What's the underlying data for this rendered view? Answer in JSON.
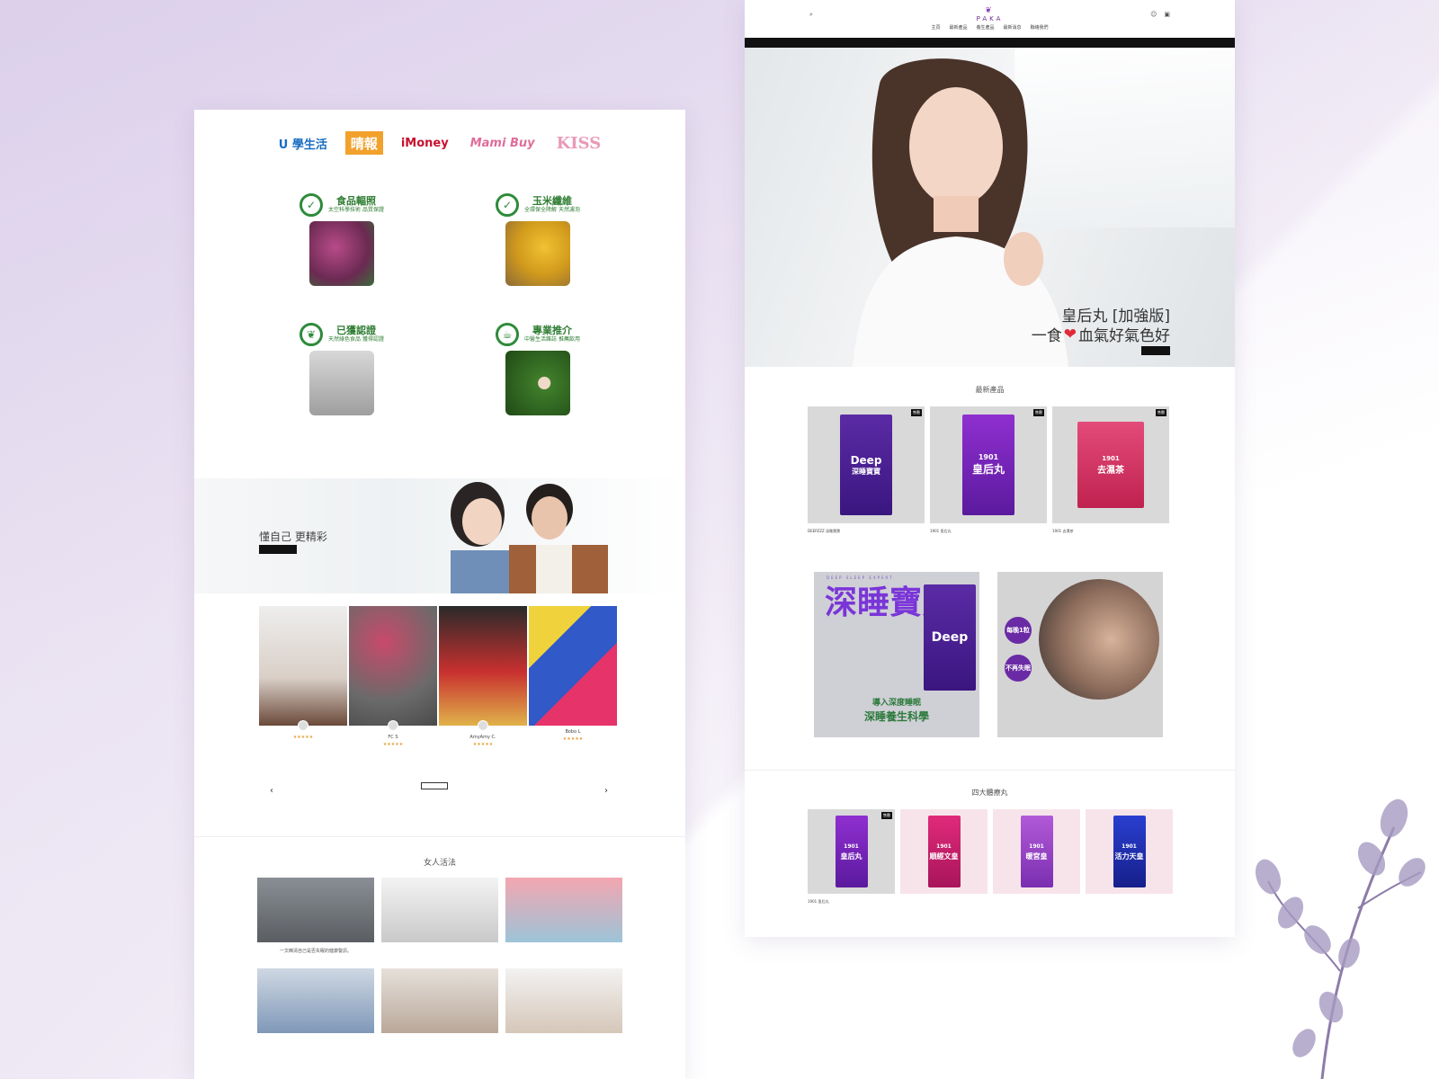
{
  "left_page": {
    "media_logos": [
      "U 學生活",
      "晴報",
      "iMoney",
      "Mami Buy",
      "KISS"
    ],
    "features": [
      {
        "title": "食品輻照",
        "subtitle": "太空科學技術 品質保證",
        "image": "rose-tea-photo",
        "icon": "shield-check-icon"
      },
      {
        "title": "玉米纖維",
        "subtitle": "全環保全降解 天然濾泡",
        "image": "teabag-photo",
        "icon": "shield-check-icon"
      },
      {
        "title": "已獲認證",
        "subtitle": "天然綠色食品 獲得認證",
        "image": "certificate-photo",
        "icon": "leaf-icon"
      },
      {
        "title": "專業推介",
        "subtitle": "中醫生活雜誌 推薦飲用",
        "image": "vine-portrait-photo",
        "icon": "teacup-icon"
      }
    ],
    "hero": {
      "title": "懂自己 更精彩"
    },
    "reviews": [
      {
        "name": "",
        "stars": "★★★★★"
      },
      {
        "name": "FC S",
        "stars": "★★★★★"
      },
      {
        "name": "AmyAmy C.",
        "stars": "★★★★★"
      },
      {
        "name": "Bobo L",
        "stars": "★★★★★"
      }
    ],
    "reviews_nav": {
      "prev": "‹",
      "next": "›"
    },
    "articles_title": "女人活法",
    "articles": [
      {
        "caption": "一文睇清自己是否失眠的健康警訊。"
      },
      {
        "caption": ""
      },
      {
        "caption": ""
      },
      {
        "caption": ""
      },
      {
        "caption": ""
      },
      {
        "caption": ""
      }
    ]
  },
  "right_page": {
    "logo": "PAKA",
    "logo_mark": "❦",
    "nav": [
      "主頁",
      "最新產品",
      "養生產品",
      "最新消息",
      "聯絡我們"
    ],
    "hero": {
      "title_line1": "皇后丸 [加強版]",
      "title_line2_before": "一食",
      "heart": "❤",
      "title_line2_after": "血氣好氣色好"
    },
    "new_products_title": "最新產品",
    "new_products": [
      {
        "tag": "售罄",
        "box_title": "Deep",
        "box_sub": "深睡寶寶",
        "caption": "DEEPZZZ 深睡寶寶",
        "price_old": "",
        "price_new": ""
      },
      {
        "tag": "售罄",
        "box_title": "1901",
        "box_sub": "皇后丸",
        "caption": "1901 皇后丸",
        "price_old": "",
        "price_new": ""
      },
      {
        "tag": "售罄",
        "box_title": "1901",
        "box_sub": "去濕茶",
        "caption": "1901 去濕茶",
        "price_old": "",
        "price_new": ""
      }
    ],
    "banner_deep": {
      "eyebrow": "DEEP SLEEP EXPERT",
      "title": "深睡寶寶",
      "box": "Deep",
      "line1": "導入深度睡眠",
      "line2": "深睡養生科學"
    },
    "banner_sleep": {
      "badge1": "每晚1粒",
      "badge2": "不再失眠"
    },
    "pills_title": "四大體療丸",
    "pills": [
      {
        "box_title": "1901",
        "box_sub": "皇后丸",
        "caption": "1901 皇后丸",
        "price": "",
        "tag": "售罄"
      },
      {
        "box_title": "1901",
        "box_sub": "順經文皇",
        "caption": "",
        "price": ""
      },
      {
        "box_title": "1901",
        "box_sub": "暖宮皇",
        "caption": "",
        "price": ""
      },
      {
        "box_title": "1901",
        "box_sub": "活力天皇",
        "caption": "",
        "price": ""
      }
    ]
  },
  "colors": {
    "accent_purple": "#7a35d8",
    "green": "#2e7d32",
    "heart_red": "#e02a3a",
    "sale_red": "#c7254e"
  }
}
